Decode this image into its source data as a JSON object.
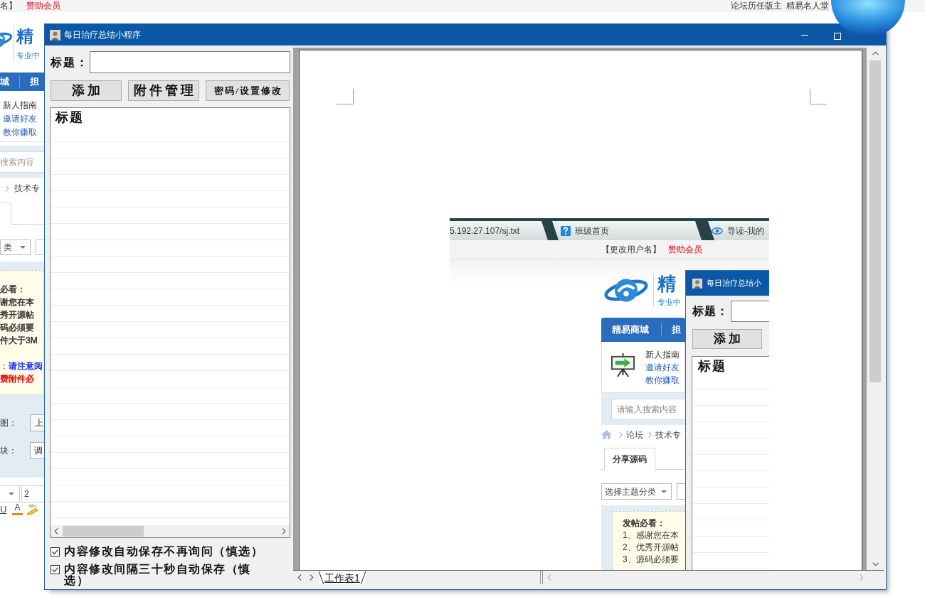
{
  "background_page": {
    "top_bar": {
      "user_links": [
        {
          "text": "名】",
          "kind": "plain"
        },
        {
          "text": "赞助会员",
          "kind": "sponsor"
        }
      ],
      "right_links": [
        "论坛历任版主",
        "精易名人堂"
      ]
    },
    "logo": {
      "mark": "精",
      "tagline": "专业中"
    },
    "nav_items": [
      "城",
      "担"
    ],
    "guide": {
      "title": "新人指南",
      "links": [
        "邀请好友",
        "教你赚取"
      ]
    },
    "search": {
      "placeholder": "搜索内容"
    },
    "breadcrumb": [
      "技术专"
    ],
    "category_select": {
      "value": "类"
    },
    "notice": {
      "title": "必看：",
      "lines": [
        {
          "text": "谢您在本",
          "color": "#333333"
        },
        {
          "text": "秀开源帖",
          "color": "#333333"
        },
        {
          "text": "码必须要",
          "color": "#333333"
        },
        {
          "text": "件大于3M",
          "color": "#333333"
        }
      ],
      "remarks": [
        {
          "prefix": "：",
          "text": "请注意阅",
          "color": "#1a33ff"
        },
        {
          "text": "费附件必",
          "color": "#e60000"
        }
      ]
    },
    "form_rows": [
      {
        "label": "图：",
        "kind": "button",
        "value": "上"
      },
      {
        "label": "块：",
        "kind": "field",
        "value": "调"
      }
    ],
    "editor": {
      "size_value": "2",
      "tools": [
        {
          "kind": "underline",
          "label": "U"
        },
        {
          "kind": "font_color",
          "label": "A"
        },
        {
          "kind": "highlight",
          "label": "abc"
        }
      ]
    }
  },
  "window": {
    "title": "每日治疗总结小程序",
    "title_label": "标题：",
    "buttons": [
      {
        "label": "添加",
        "kind": "large"
      },
      {
        "label": "附件管理",
        "kind": "large"
      },
      {
        "label": "密码/设置修改",
        "kind": "small"
      }
    ],
    "list_items": [
      "标题"
    ],
    "options": [
      {
        "label": "内容修改自动保存不再询问（慎选）",
        "checked": true
      },
      {
        "label": "内容修改间隔三十秒自动保存（慎选）",
        "checked": true
      }
    ]
  },
  "document": {
    "embedded_screenshot": {
      "browser_tabs": [
        {
          "title": "5.192.27.107/sj.txt",
          "kind": "plain"
        },
        {
          "title": "班级首页",
          "kind": "help"
        },
        {
          "title": "导读-我的",
          "kind": "eye"
        }
      ],
      "user_links": [
        {
          "text": "【更改用户名】",
          "kind": "plain"
        },
        {
          "text": "赞助会员",
          "kind": "sponsor"
        }
      ],
      "logo": {
        "mark": "精",
        "tagline": "专业中"
      },
      "nav_items": [
        "精易商城",
        "担"
      ],
      "guide": {
        "title": "新人指南",
        "links": [
          "邀请好友",
          "教你赚取"
        ]
      },
      "search": {
        "placeholder": "请输入搜索内容"
      },
      "breadcrumb": [
        "论坛",
        "技术专"
      ],
      "tabs": [
        {
          "label": "分享源码",
          "selected": true
        }
      ],
      "category_select": {
        "value": "选择主题分类"
      },
      "notice": {
        "title": "发帖必看：",
        "lines": [
          {
            "text": "1、感谢您在本",
            "color": "#333333"
          },
          {
            "text": "2、优秀开源帖",
            "color": "#333333"
          },
          {
            "text": "3、源码必须要",
            "color": "#333333"
          }
        ]
      },
      "app_window": {
        "title": "每日治疗总结小",
        "title_label": "标题：",
        "buttons": [
          "添加"
        ],
        "list_items": [
          "标题"
        ]
      }
    },
    "sheet_tabs": [
      {
        "label": "工作表1",
        "selected": true
      }
    ]
  }
}
